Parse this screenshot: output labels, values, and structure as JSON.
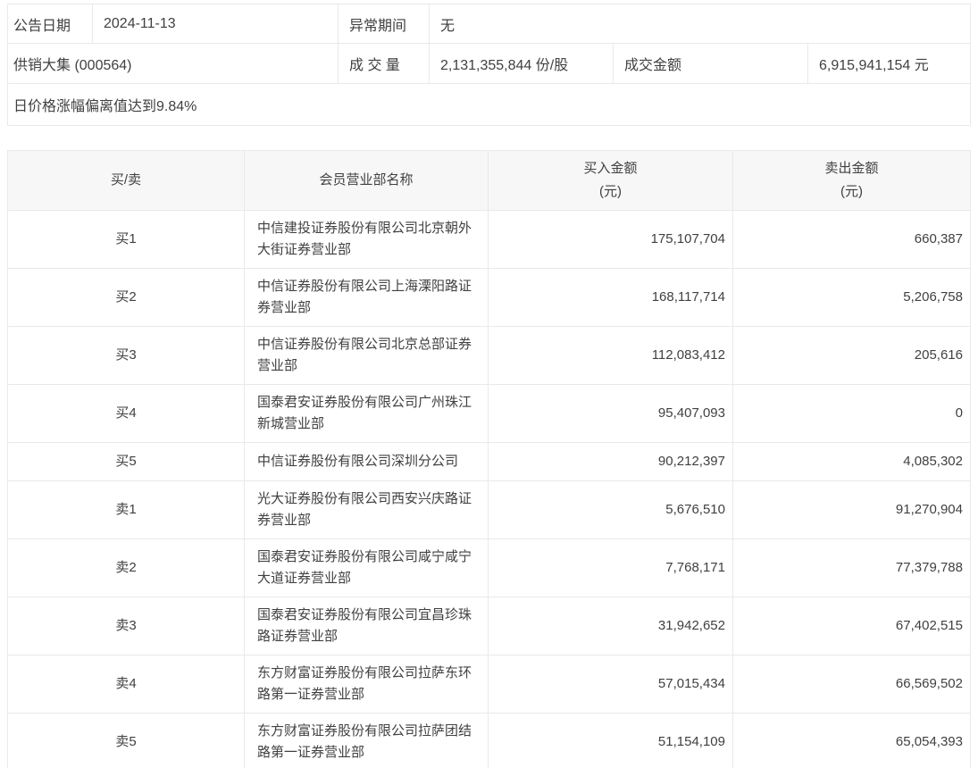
{
  "colors": {
    "border": "#e9e9e9",
    "header_bg": "#f7f7f7",
    "text": "#404040",
    "page_bg": "#ffffff"
  },
  "summary": {
    "announce_date": {
      "label": "公告日期",
      "value": "2024-11-13"
    },
    "abnormal_period": {
      "label": "异常期间",
      "value": "无"
    },
    "stock_title": "供销大集 (000564)",
    "volume": {
      "label": "成 交 量",
      "value": "2,131,355,844 份/股"
    },
    "turnover": {
      "label": "成交金额",
      "value": "6,915,941,154 元"
    },
    "deviation_note": "日价格涨幅偏离值达到9.84%"
  },
  "broker_table": {
    "headers": {
      "side": "买/卖",
      "branch": "会员营业部名称",
      "buy_line1": "买入金额",
      "buy_line2": "(元)",
      "sell_line1": "卖出金额",
      "sell_line2": "(元)"
    },
    "rows": [
      {
        "side": "买1",
        "branch": "中信建投证券股份有限公司北京朝外大街证券营业部",
        "buy": "175,107,704",
        "sell": "660,387"
      },
      {
        "side": "买2",
        "branch": "中信证券股份有限公司上海溧阳路证券营业部",
        "buy": "168,117,714",
        "sell": "5,206,758"
      },
      {
        "side": "买3",
        "branch": "中信证券股份有限公司北京总部证券营业部",
        "buy": "112,083,412",
        "sell": "205,616"
      },
      {
        "side": "买4",
        "branch": "国泰君安证券股份有限公司广州珠江新城营业部",
        "buy": "95,407,093",
        "sell": "0"
      },
      {
        "side": "买5",
        "branch": "中信证券股份有限公司深圳分公司",
        "buy": "90,212,397",
        "sell": "4,085,302"
      },
      {
        "side": "卖1",
        "branch": "光大证券股份有限公司西安兴庆路证券营业部",
        "buy": "5,676,510",
        "sell": "91,270,904"
      },
      {
        "side": "卖2",
        "branch": "国泰君安证券股份有限公司咸宁咸宁大道证券营业部",
        "buy": "7,768,171",
        "sell": "77,379,788"
      },
      {
        "side": "卖3",
        "branch": "国泰君安证券股份有限公司宜昌珍珠路证券营业部",
        "buy": "31,942,652",
        "sell": "67,402,515"
      },
      {
        "side": "卖4",
        "branch": "东方财富证券股份有限公司拉萨东环路第一证券营业部",
        "buy": "57,015,434",
        "sell": "66,569,502"
      },
      {
        "side": "卖5",
        "branch": "东方财富证券股份有限公司拉萨团结路第一证券营业部",
        "buy": "51,154,109",
        "sell": "65,054,393"
      }
    ]
  }
}
